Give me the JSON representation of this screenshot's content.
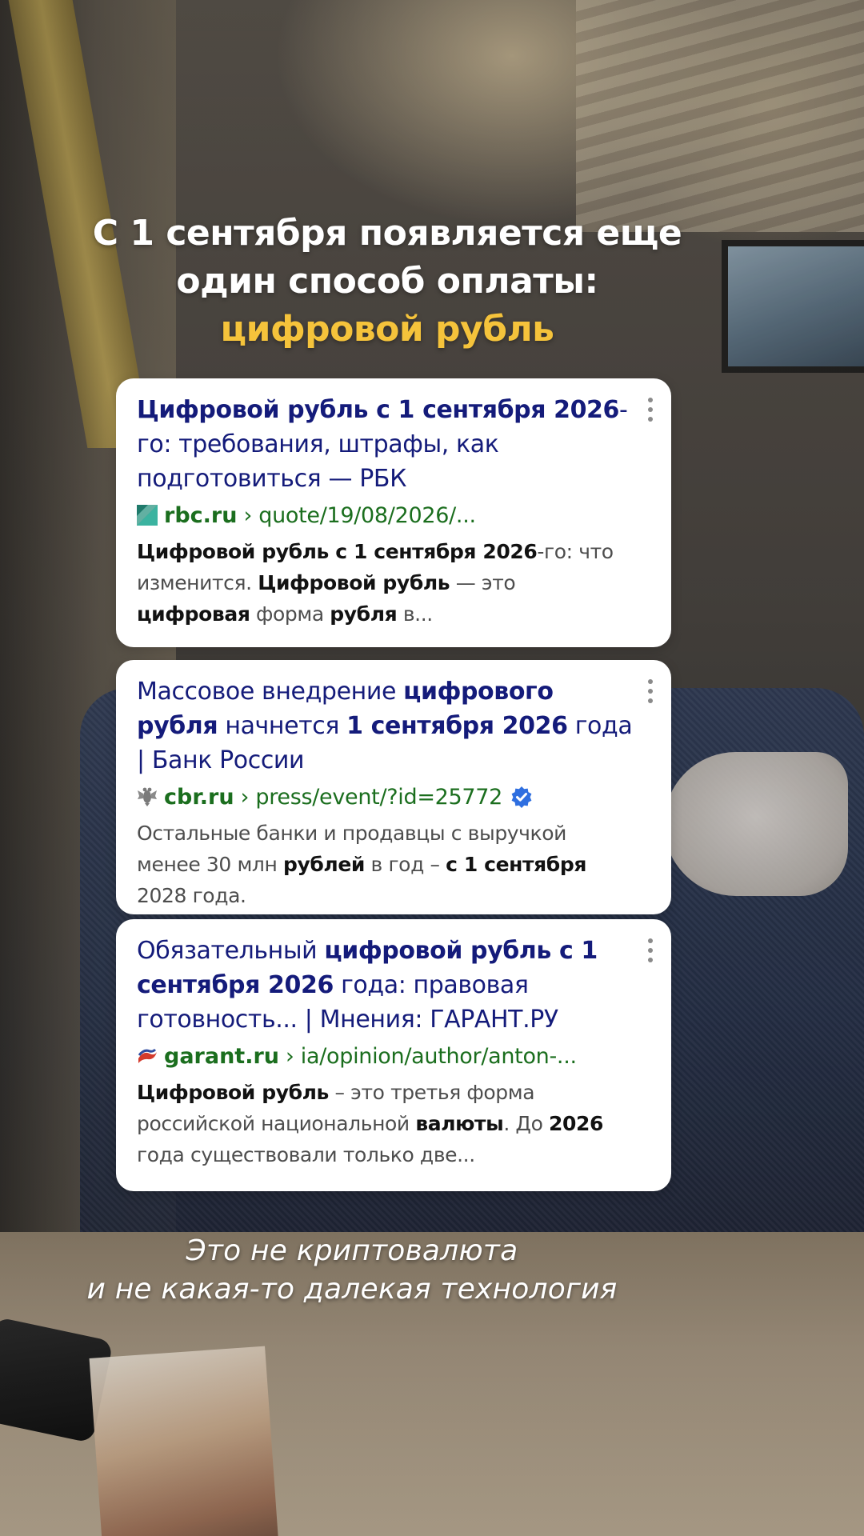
{
  "headline": {
    "line1": "С 1 сентября появляется еще",
    "line2": "один способ оплаты:",
    "accent": "цифровой рубль"
  },
  "results": [
    {
      "title": "Цифровой рубль с 1 сентября 2026-го: требования, штрафы, как подготовиться — РБК",
      "domain": "rbc.ru",
      "path": "› quote/19/08/2026/...",
      "favicon_icon": "rbc-favicon-icon",
      "snippet": "Цифровой рубль с 1 сентября 2026-го: что изменится. Цифровой рубль — это цифровая форма рубля в..."
    },
    {
      "title": "Массовое внедрение цифрового рубля начнется 1 сентября 2026 года | Банк России",
      "domain": "cbr.ru",
      "path": "› press/event/?id=25772",
      "favicon_icon": "cbr-eagle-icon",
      "verified_icon": "verified-check-icon",
      "snippet": "Остальные банки и продавцы с выручкой менее 30 млн рублей в год – с 1 сентября 2028 года."
    },
    {
      "title": "Обязательный цифровой рубль с 1 сентября 2026 года: правовая готовность... | Мнения: ГАРАНТ.РУ",
      "domain": "garant.ru",
      "path": "› ia/opinion/author/anton-...",
      "favicon_icon": "garant-favicon-icon",
      "snippet": "Цифровой рубль – это третья форма российской национальной валюты. До 2026 года существовали только две..."
    }
  ],
  "caption": {
    "line1": "Это не криптовалюта",
    "line2": "и не какая-то далекая технология"
  },
  "colors": {
    "accent": "#f5c33b",
    "title_link": "#141b7a",
    "url_green": "#1b6e1e",
    "verified_blue": "#2f6fe0"
  }
}
